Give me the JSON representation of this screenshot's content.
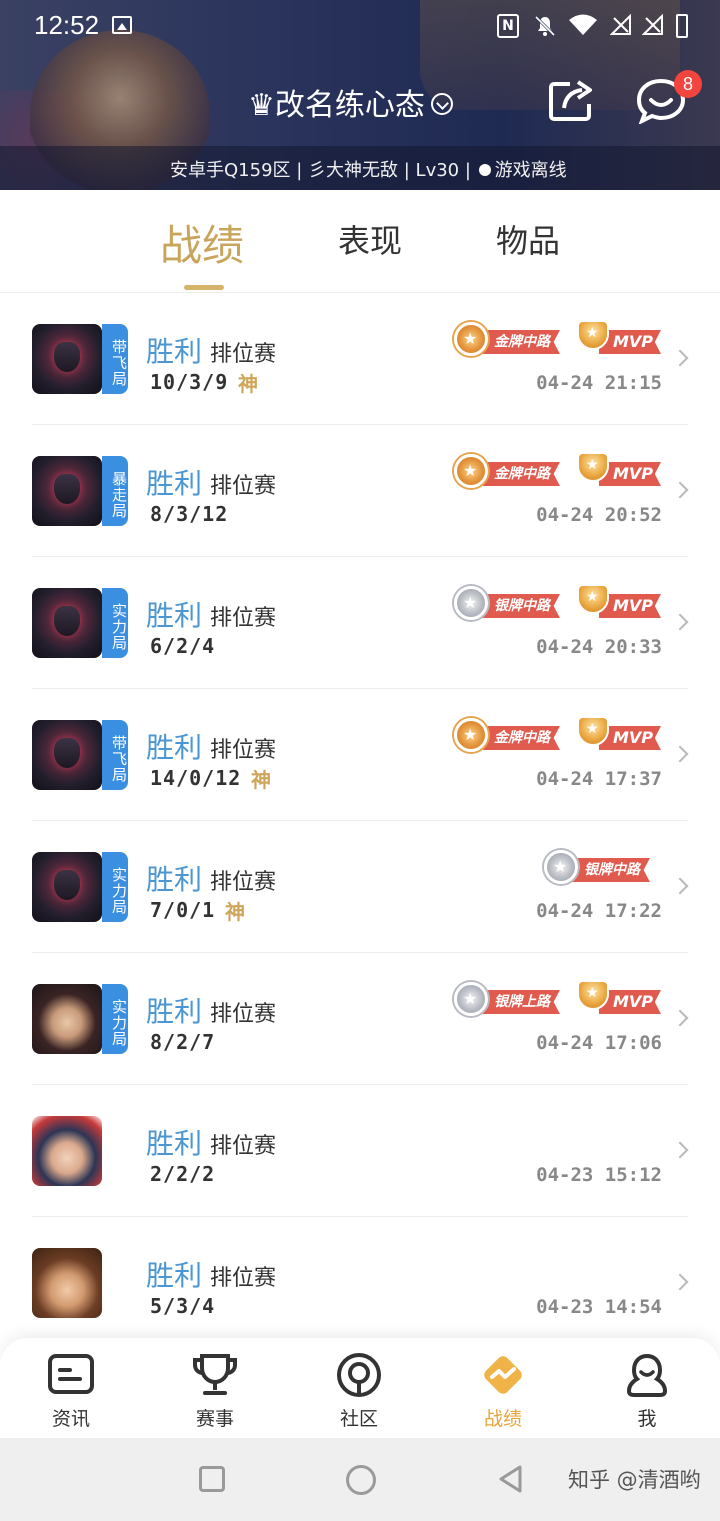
{
  "status_bar": {
    "time": "12:52",
    "nfc_label": "N"
  },
  "header": {
    "title": "♛改名练心态",
    "notification_count": "8",
    "sub_info": "安卓手Q159区 | 彡大神无敌 | Lv30 | ",
    "online_status": "游戏离线"
  },
  "tabs": [
    {
      "label": "战绩",
      "active": true
    },
    {
      "label": "表现",
      "active": false
    },
    {
      "label": "物品",
      "active": false
    }
  ],
  "matches": [
    {
      "mode_tag": "带飞局",
      "result": "胜利",
      "mode": "排位赛",
      "kda": "10/3/9",
      "god": "神",
      "lane_medal": "gold",
      "lane_badge": "金牌中路",
      "mvp": "MVP",
      "time": "04-24 21:15",
      "hero": "dark"
    },
    {
      "mode_tag": "暴走局",
      "result": "胜利",
      "mode": "排位赛",
      "kda": "8/3/12",
      "god": "",
      "lane_medal": "gold",
      "lane_badge": "金牌中路",
      "mvp": "MVP",
      "time": "04-24 20:52",
      "hero": "dark"
    },
    {
      "mode_tag": "实力局",
      "result": "胜利",
      "mode": "排位赛",
      "kda": "6/2/4",
      "god": "",
      "lane_medal": "silver",
      "lane_badge": "银牌中路",
      "mvp": "MVP",
      "time": "04-24 20:33",
      "hero": "dark"
    },
    {
      "mode_tag": "带飞局",
      "result": "胜利",
      "mode": "排位赛",
      "kda": "14/0/12",
      "god": "神",
      "lane_medal": "gold",
      "lane_badge": "金牌中路",
      "mvp": "MVP",
      "time": "04-24 17:37",
      "hero": "dark"
    },
    {
      "mode_tag": "实力局",
      "result": "胜利",
      "mode": "排位赛",
      "kda": "7/0/1",
      "god": "神",
      "lane_medal": "silver",
      "lane_badge": "银牌中路",
      "mvp": "",
      "time": "04-24 17:22",
      "hero": "dark"
    },
    {
      "mode_tag": "实力局",
      "result": "胜利",
      "mode": "排位赛",
      "kda": "8/2/7",
      "god": "",
      "lane_medal": "silver",
      "lane_badge": "银牌上路",
      "mvp": "MVP",
      "time": "04-24 17:06",
      "hero": "girl1"
    },
    {
      "mode_tag": "",
      "result": "胜利",
      "mode": "排位赛",
      "kda": "2/2/2",
      "god": "",
      "lane_medal": "",
      "lane_badge": "",
      "mvp": "",
      "time": "04-23 15:12",
      "hero": "girl2"
    },
    {
      "mode_tag": "",
      "result": "胜利",
      "mode": "排位赛",
      "kda": "5/3/4",
      "god": "",
      "lane_medal": "",
      "lane_badge": "",
      "mvp": "",
      "time": "04-23 14:54",
      "hero": "girl3"
    }
  ],
  "bottom_nav": [
    {
      "label": "资讯",
      "icon": "news-icon",
      "active": false
    },
    {
      "label": "赛事",
      "icon": "trophy-icon",
      "active": false
    },
    {
      "label": "社区",
      "icon": "community-icon",
      "active": false
    },
    {
      "label": "战绩",
      "icon": "record-icon",
      "active": true
    },
    {
      "label": "我",
      "icon": "profile-icon",
      "active": false
    }
  ],
  "watermark": "知乎 @清酒哟",
  "colors": {
    "accent_gold": "#c9a45b",
    "win_blue": "#4a97d4",
    "mode_tag_blue": "#3b8fe0",
    "ribbon_red": "#e05a4e",
    "nav_active": "#e7a43a",
    "badge_red": "#f2453d"
  }
}
